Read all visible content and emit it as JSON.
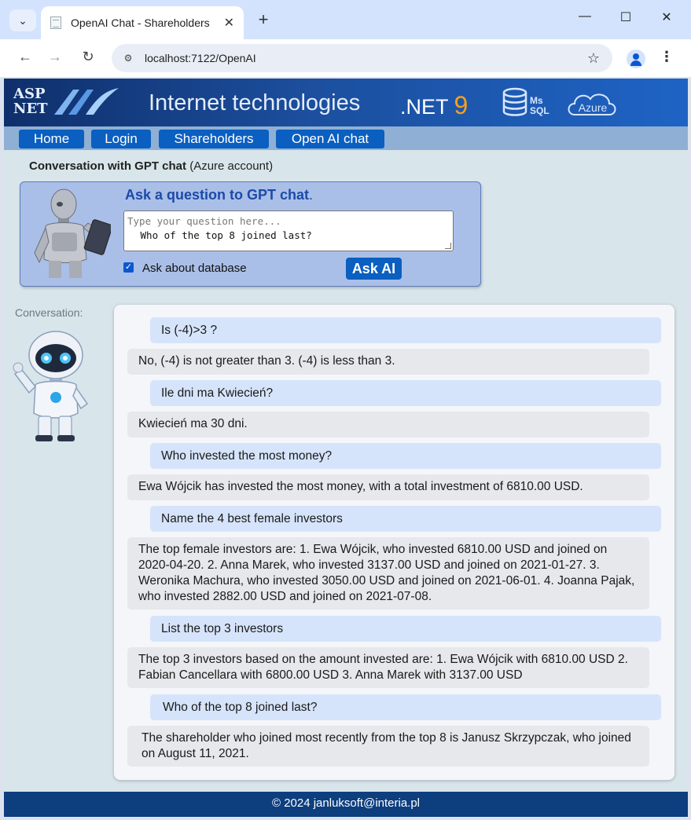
{
  "browser": {
    "tab_title": "OpenAI Chat - Shareholders",
    "url": "localhost:7122/OpenAI"
  },
  "banner": {
    "asp_line1": "ASP",
    "asp_line2": "NET",
    "title": "Internet technologies",
    "net_prefix": ".NET ",
    "net_version": "9",
    "ms_label": "Ms",
    "sql_label": "SQL",
    "azure_label": "Azure"
  },
  "nav": {
    "items": [
      "Home",
      "Login",
      "Shareholders",
      "Open AI chat"
    ]
  },
  "heading": {
    "bold": "Conversation with GPT chat",
    "rest": " (Azure account)"
  },
  "ask": {
    "title": "Ask a question to GPT chat",
    "title_suffix": ".",
    "placeholder": "Type your question here...",
    "value": " Who of the top 8 joined last?",
    "checkbox_label": "Ask about database",
    "checkbox_checked": true,
    "button_label": "Ask AI"
  },
  "conversation": {
    "label": "Conversation:",
    "messages": [
      {
        "role": "user",
        "text": "Is (-4)>3 ?"
      },
      {
        "role": "ai",
        "text": "No, (-4) is not greater than 3. (-4) is less than 3."
      },
      {
        "role": "user",
        "text": "Ile dni ma Kwiecień?"
      },
      {
        "role": "ai",
        "text": "Kwiecień ma 30 dni."
      },
      {
        "role": "user",
        "text": "Who invested the most money?"
      },
      {
        "role": "ai",
        "text": "Ewa Wójcik has invested the most money, with a total investment of 6810.00 USD."
      },
      {
        "role": "user",
        "text": "Name the 4 best female investors"
      },
      {
        "role": "ai",
        "text": "The top female investors are: 1. Ewa Wójcik, who invested 6810.00 USD and joined on 2020-04-20. 2. Anna Marek, who invested 3137.00 USD and joined on 2021-01-27. 3. Weronika Machura, who invested 3050.00 USD and joined on 2021-06-01. 4. Joanna Pajak, who invested 2882.00 USD and joined on 2021-07-08."
      },
      {
        "role": "user",
        "text": "List the top 3 investors"
      },
      {
        "role": "ai",
        "text": "The top 3 investors based on the amount invested are: 1. Ewa Wójcik with 6810.00 USD 2. Fabian Cancellara with 6800.00 USD 3. Anna Marek with 3137.00 USD"
      },
      {
        "role": "user",
        "text": "Who of the top 8 joined last?"
      },
      {
        "role": "ai",
        "text": "The shareholder who joined most recently from the top 8 is Janusz Skrzypczak, who joined on August 11, 2021."
      }
    ]
  },
  "footer": {
    "text": "© 2024 janluksoft@interia.pl"
  },
  "colors": {
    "banner": "#1c4f9e",
    "nav_button": "#0a5fc0",
    "user_bubble": "#d6e4fb",
    "ai_bubble": "#e6e8eb",
    "footer": "#0d3e7e",
    "accent_9": "#f5a11a"
  },
  "icons": [
    "chevron-down-icon",
    "page-icon",
    "close-icon",
    "plus-icon",
    "minimize-icon",
    "maximize-icon",
    "back-arrow-icon",
    "forward-arrow-icon",
    "reload-icon",
    "site-settings-icon",
    "star-icon",
    "profile-icon",
    "more-menu-icon",
    "database-icon",
    "cloud-icon",
    "robot-icon"
  ]
}
